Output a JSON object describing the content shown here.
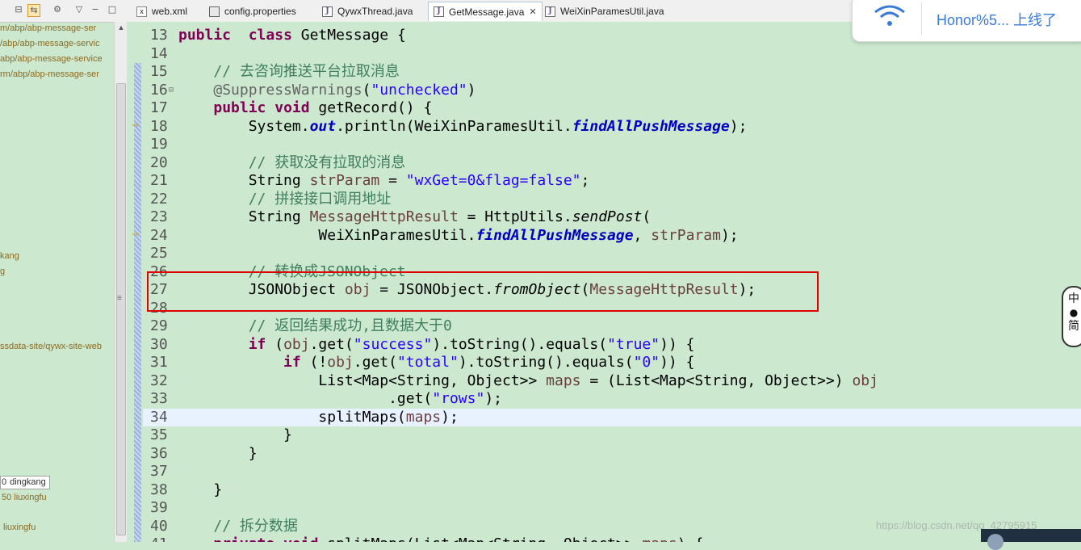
{
  "explorer": {
    "items": [
      "m/abp/abp-message-ser",
      "/abp/abp-message-servic",
      "abp/abp-message-service",
      "rm/abp/abp-message-ser",
      "kang",
      "g",
      "ssdata-site/qywx-site-web",
      "dingkang",
      "50  liuxingfu",
      "liuxingfu"
    ]
  },
  "tabs": [
    {
      "label": "web.xml",
      "icon": "xml-file-icon"
    },
    {
      "label": "config.properties",
      "icon": "properties-file-icon"
    },
    {
      "label": "QywxThread.java",
      "icon": "java-file-icon"
    },
    {
      "label": "GetMessage.java",
      "icon": "java-file-icon",
      "active": true
    },
    {
      "label": "WeiXinParamesUtil.java",
      "icon": "java-file-icon"
    }
  ],
  "editor": {
    "lines": [
      {
        "n": "13",
        "tokens": [
          [
            "kw",
            "public"
          ],
          [
            "",
            "  "
          ],
          [
            "kw",
            "class"
          ],
          [
            "",
            " GetMessage {"
          ]
        ]
      },
      {
        "n": "14",
        "tokens": []
      },
      {
        "n": "15",
        "tokens": [
          [
            "",
            "    "
          ],
          [
            "cmt",
            "// 去咨询推送平台拉取消息"
          ]
        ]
      },
      {
        "n": "16",
        "fold": true,
        "tokens": [
          [
            "",
            "    "
          ],
          [
            "ann",
            "@SuppressWarnings"
          ],
          [
            "",
            "("
          ],
          [
            "str",
            "\"unchecked\""
          ],
          [
            "",
            ")"
          ]
        ]
      },
      {
        "n": "17",
        "tokens": [
          [
            "",
            "    "
          ],
          [
            "kw",
            "public"
          ],
          [
            "",
            " "
          ],
          [
            "kw",
            "void"
          ],
          [
            "",
            " getRecord() {"
          ]
        ]
      },
      {
        "n": "18",
        "tokens": [
          [
            "",
            "        System."
          ],
          [
            "fld",
            "out"
          ],
          [
            "",
            ".println(WeiXinParamesUtil."
          ],
          [
            "fld",
            "findAllPushMessage"
          ],
          [
            "",
            ");"
          ]
        ]
      },
      {
        "n": "19",
        "tokens": []
      },
      {
        "n": "20",
        "tokens": [
          [
            "",
            "        "
          ],
          [
            "cmt",
            "// 获取没有拉取的消息"
          ]
        ]
      },
      {
        "n": "21",
        "tokens": [
          [
            "",
            "        String "
          ],
          [
            "var",
            "strParam"
          ],
          [
            "",
            " = "
          ],
          [
            "str",
            "\"wxGet=0&flag=false\""
          ],
          [
            "",
            ";"
          ]
        ]
      },
      {
        "n": "22",
        "tokens": [
          [
            "",
            "        "
          ],
          [
            "cmt",
            "// 拼接接口调用地址"
          ]
        ]
      },
      {
        "n": "23",
        "tokens": [
          [
            "",
            "        String "
          ],
          [
            "var",
            "MessageHttpResult"
          ],
          [
            "",
            " = HttpUtils."
          ],
          [
            "sfn",
            "sendPost"
          ],
          [
            "",
            "("
          ]
        ]
      },
      {
        "n": "24",
        "tokens": [
          [
            "",
            "                WeiXinParamesUtil."
          ],
          [
            "fld",
            "findAllPushMessage"
          ],
          [
            "",
            ", "
          ],
          [
            "var",
            "strParam"
          ],
          [
            "",
            ");"
          ]
        ]
      },
      {
        "n": "25",
        "tokens": []
      },
      {
        "n": "26",
        "tokens": [
          [
            "",
            "        "
          ],
          [
            "cmt",
            "// 转换成JSONObject"
          ]
        ]
      },
      {
        "n": "27",
        "tokens": [
          [
            "",
            "        JSONObject "
          ],
          [
            "var",
            "obj"
          ],
          [
            "",
            " = JSONObject."
          ],
          [
            "sfn",
            "fromObject"
          ],
          [
            "",
            "("
          ],
          [
            "var",
            "MessageHttpResult"
          ],
          [
            "",
            ");"
          ]
        ]
      },
      {
        "n": "28",
        "tokens": []
      },
      {
        "n": "29",
        "tokens": [
          [
            "",
            "        "
          ],
          [
            "cmt",
            "// 返回结果成功,且数据大于0"
          ]
        ]
      },
      {
        "n": "30",
        "tokens": [
          [
            "",
            "        "
          ],
          [
            "kw",
            "if"
          ],
          [
            "",
            " ("
          ],
          [
            "var",
            "obj"
          ],
          [
            "",
            ".get("
          ],
          [
            "str",
            "\"success\""
          ],
          [
            "",
            ").toString().equals("
          ],
          [
            "str",
            "\"true\""
          ],
          [
            "",
            ")) {"
          ]
        ]
      },
      {
        "n": "31",
        "tokens": [
          [
            "",
            "            "
          ],
          [
            "kw",
            "if"
          ],
          [
            "",
            " (!"
          ],
          [
            "var",
            "obj"
          ],
          [
            "",
            ".get("
          ],
          [
            "str",
            "\"total\""
          ],
          [
            "",
            ").toString().equals("
          ],
          [
            "str",
            "\"0\""
          ],
          [
            "",
            ")) {"
          ]
        ]
      },
      {
        "n": "32",
        "tokens": [
          [
            "",
            "                List<Map<String, Object>> "
          ],
          [
            "var",
            "maps"
          ],
          [
            "",
            " = (List<Map<String, Object>>) "
          ],
          [
            "var",
            "obj"
          ]
        ]
      },
      {
        "n": "33",
        "tokens": [
          [
            "",
            "                        .get("
          ],
          [
            "str",
            "\"rows\""
          ],
          [
            "",
            ");"
          ]
        ]
      },
      {
        "n": "34",
        "current": true,
        "tokens": [
          [
            "",
            "                splitMaps("
          ],
          [
            "var",
            "maps"
          ],
          [
            "",
            ");"
          ]
        ]
      },
      {
        "n": "35",
        "tokens": [
          [
            "",
            "            }"
          ]
        ]
      },
      {
        "n": "36",
        "tokens": [
          [
            "",
            "        }"
          ]
        ]
      },
      {
        "n": "37",
        "tokens": []
      },
      {
        "n": "38",
        "tokens": [
          [
            "",
            "    }"
          ]
        ]
      },
      {
        "n": "39",
        "tokens": []
      },
      {
        "n": "40",
        "tokens": [
          [
            "",
            "    "
          ],
          [
            "cmt",
            "// 拆分数据"
          ]
        ]
      },
      {
        "n": "41",
        "tokens": [
          [
            "",
            "    "
          ],
          [
            "kw",
            "private"
          ],
          [
            "",
            " "
          ],
          [
            "kw",
            "void"
          ],
          [
            "",
            " splitMaps(List<Map<String, Object>> "
          ],
          [
            "var",
            "maps"
          ],
          [
            "",
            ") {"
          ]
        ]
      }
    ]
  },
  "notification": {
    "message": "Honor%5... 上线了",
    "icon": "wifi-icon"
  },
  "ime": {
    "line1": "中",
    "line2": "简"
  },
  "watermark": "https://blog.csdn.net/qq_42795915",
  "colors": {
    "editor_bg": "#cce8cf",
    "highlight_box": "#e00000",
    "current_line": "#e8f2fe"
  }
}
